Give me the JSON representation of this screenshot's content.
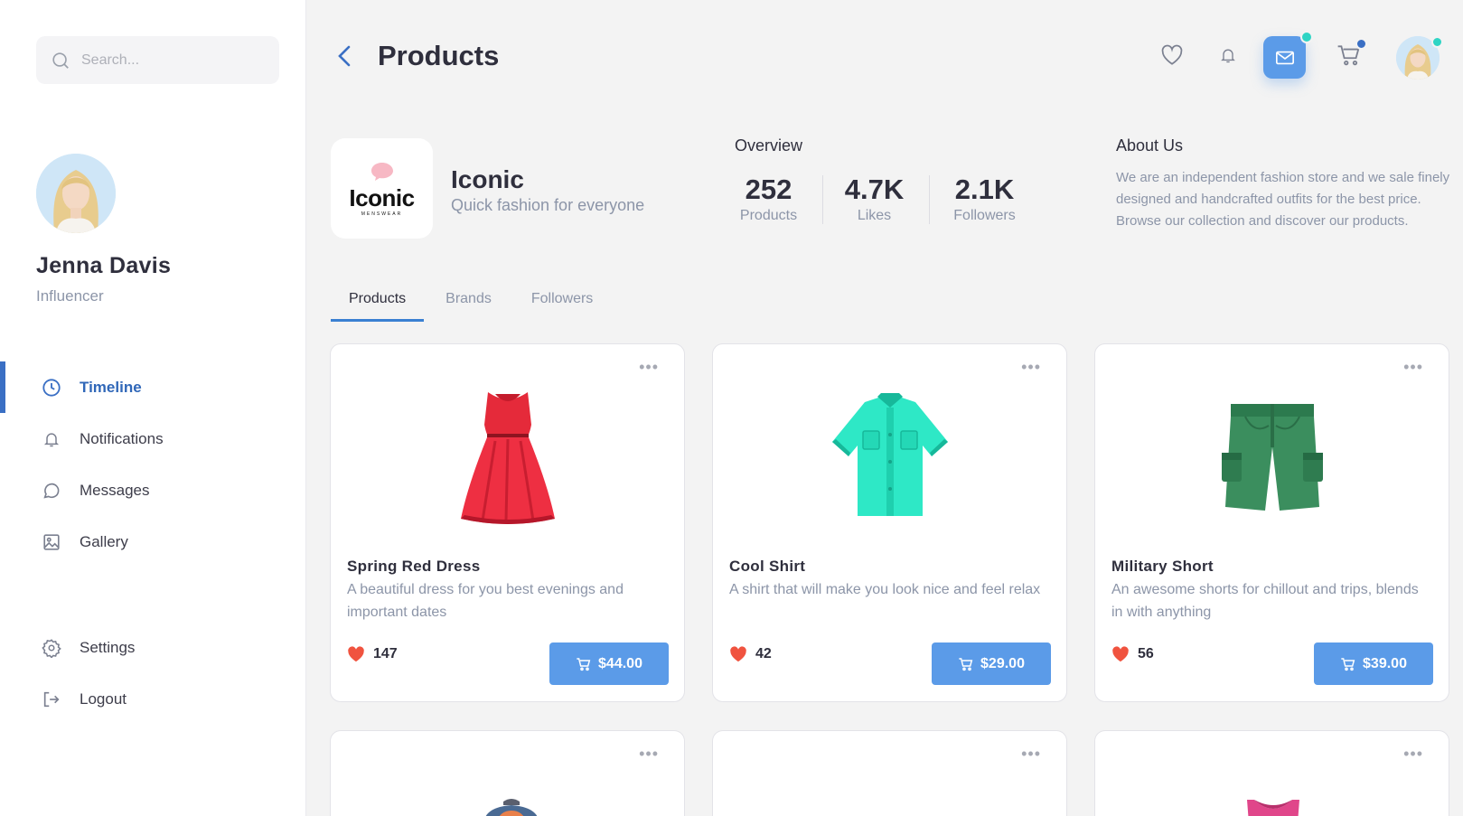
{
  "sidebar": {
    "search_placeholder": "Search...",
    "profile": {
      "name": "Jenna Davis",
      "role": "Influencer"
    },
    "nav": [
      {
        "label": "Timeline",
        "icon": "clock-icon",
        "active": true
      },
      {
        "label": "Notifications",
        "icon": "bell-icon"
      },
      {
        "label": "Messages",
        "icon": "chat-bubble-icon"
      },
      {
        "label": "Gallery",
        "icon": "image-icon"
      }
    ],
    "nav_secondary": [
      {
        "label": "Settings",
        "icon": "gear-icon"
      },
      {
        "label": "Logout",
        "icon": "logout-icon"
      }
    ]
  },
  "header": {
    "title": "Products",
    "icons": [
      "heart-icon",
      "bell-icon",
      "mail-icon",
      "cart-icon"
    ],
    "accent": "#5b9be8",
    "mail_dot_color": "#2ed4c4",
    "cart_dot_color": "#3a6fc4"
  },
  "brand": {
    "logo_text": "Iconic",
    "logo_sub": "MENSWEAR",
    "name": "Iconic",
    "tagline": "Quick fashion for everyone"
  },
  "overview": {
    "label": "Overview",
    "stats": [
      {
        "value": "252",
        "label": "Products"
      },
      {
        "value": "4.7K",
        "label": "Likes"
      },
      {
        "value": "2.1K",
        "label": "Followers"
      }
    ]
  },
  "about": {
    "label": "About Us",
    "text": "We are an independent fashion store and we sale finely designed and handcrafted outfits for the best price. Browse our collection and discover our products."
  },
  "tabs": [
    {
      "label": "Products",
      "active": true
    },
    {
      "label": "Brands"
    },
    {
      "label": "Followers"
    }
  ],
  "products": [
    {
      "title": "Spring Red Dress",
      "description": "A beautiful dress for you best evenings and important dates",
      "likes": "147",
      "price": "$44.00",
      "image": "red-dress"
    },
    {
      "title": "Cool Shirt",
      "description": "A shirt that will make you look nice and feel relax",
      "likes": "42",
      "price": "$29.00",
      "image": "teal-shirt"
    },
    {
      "title": "Military Short",
      "description": "An awesome shorts for chillout and trips, blends in with anything",
      "likes": "56",
      "price": "$39.00",
      "image": "green-shorts"
    }
  ],
  "more_icon": "•••"
}
